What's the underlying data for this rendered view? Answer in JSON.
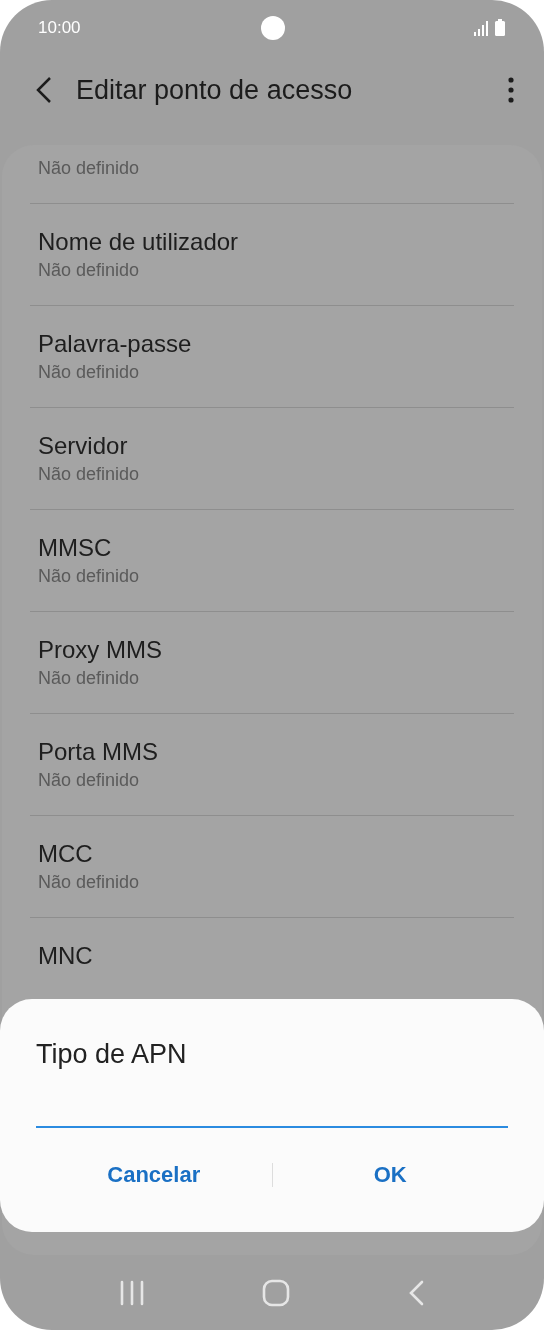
{
  "status_bar": {
    "time": "10:00"
  },
  "header": {
    "title": "Editar ponto de acesso"
  },
  "settings": [
    {
      "subtitle": "Não definido"
    },
    {
      "title": "Nome de utilizador",
      "subtitle": "Não definido"
    },
    {
      "title": "Palavra-passe",
      "subtitle": "Não definido"
    },
    {
      "title": "Servidor",
      "subtitle": "Não definido"
    },
    {
      "title": "MMSC",
      "subtitle": "Não definido"
    },
    {
      "title": "Proxy MMS",
      "subtitle": "Não definido"
    },
    {
      "title": "Porta MMS",
      "subtitle": "Não definido"
    },
    {
      "title": "MCC",
      "subtitle": "Não definido"
    },
    {
      "title": "MNC"
    }
  ],
  "dialog": {
    "title": "Tipo de APN",
    "buttons": [
      "Cancelar",
      "OK"
    ]
  }
}
